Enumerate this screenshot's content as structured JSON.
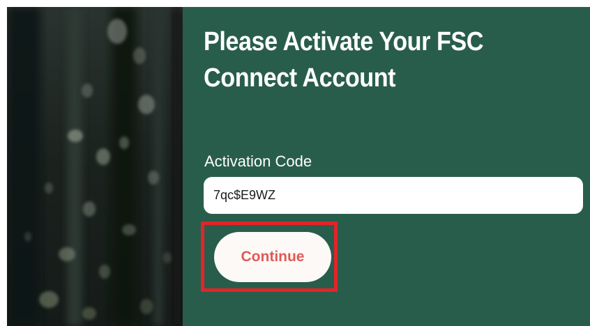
{
  "page": {
    "heading": "Please Activate Your FSC Connect Account"
  },
  "form": {
    "code_label": "Activation Code",
    "code_value": "7qc$E9WZ",
    "continue_label": "Continue"
  },
  "colors": {
    "panel_green": "#295d4b",
    "button_text": "#e05a55",
    "highlight_red": "#e3242b",
    "heading_text": "#ffffff"
  }
}
